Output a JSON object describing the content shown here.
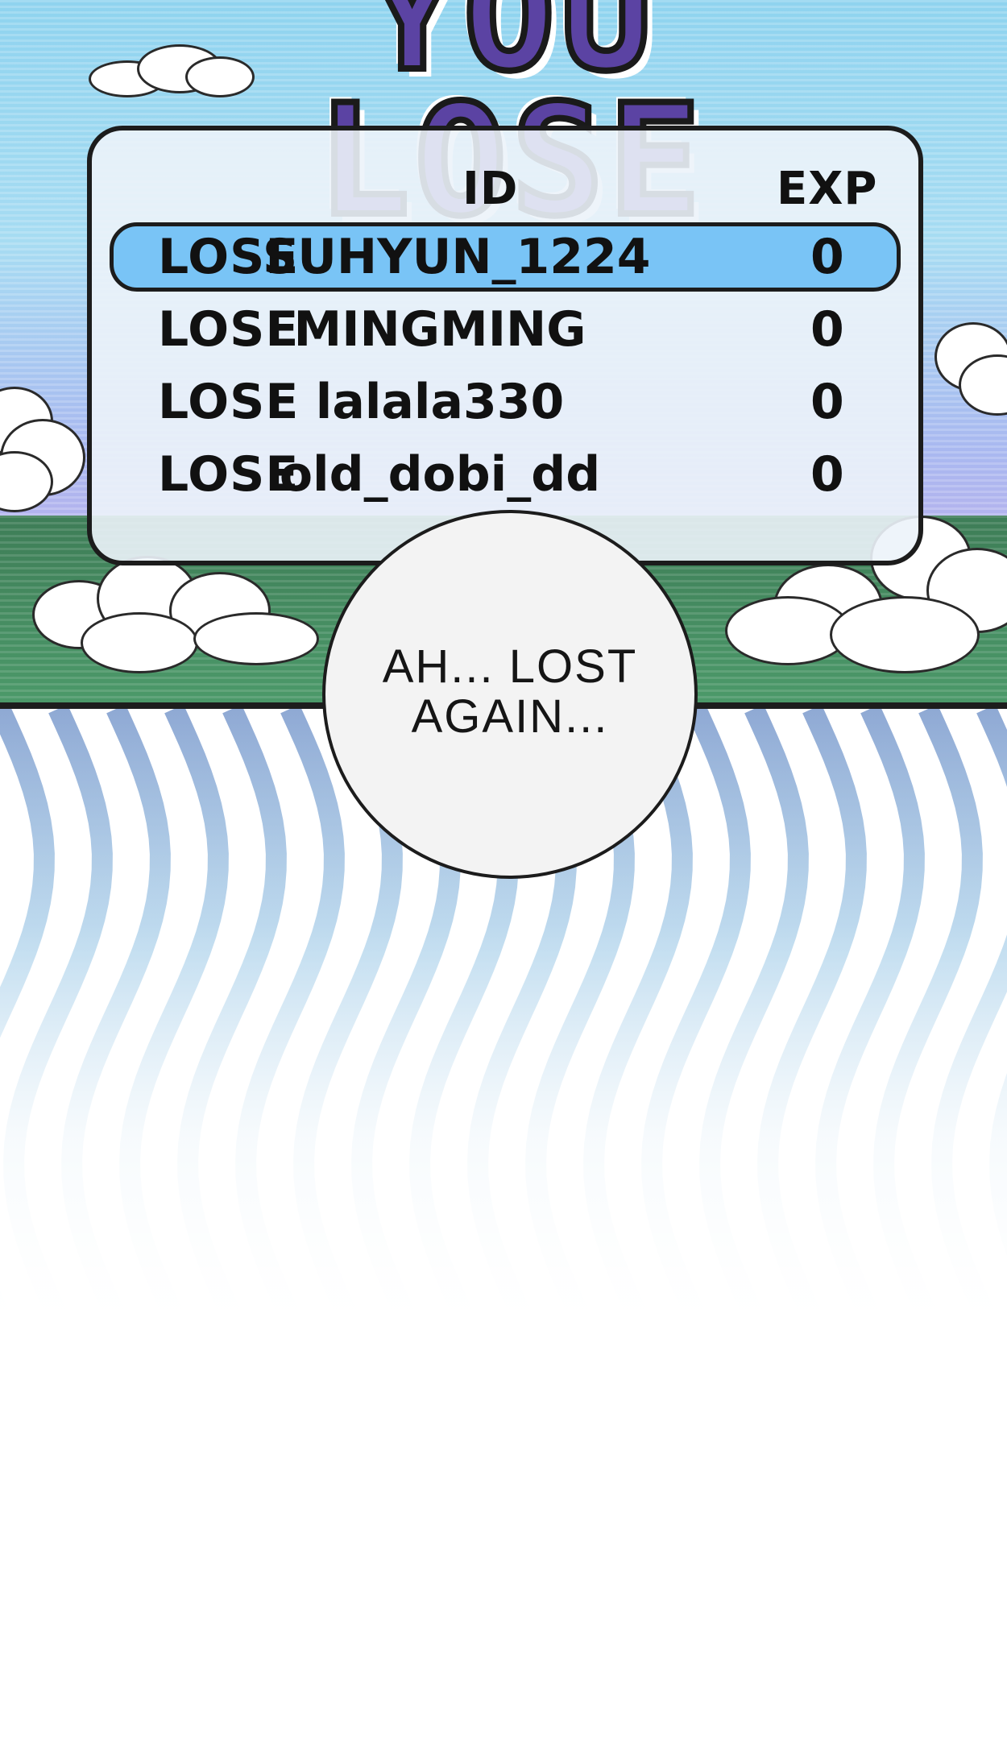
{
  "title": "YOU LOSE",
  "scoreboard": {
    "header": {
      "id_label": "ID",
      "exp_label": "EXP"
    },
    "rows": [
      {
        "status": "LOSE",
        "id": "SUHYUN_1224",
        "exp": "0"
      },
      {
        "status": "LOSE",
        "id": "MINGMING",
        "exp": "0"
      },
      {
        "status": "LOSE",
        "id": "lalala330",
        "exp": "0"
      },
      {
        "status": "LOSE",
        "id": "old_dobi_dd",
        "exp": "0"
      }
    ]
  },
  "speech_bubble": {
    "line1": "AH... LOST",
    "line2": "AGAIN..."
  },
  "colors": {
    "sky": "#8fd3ef",
    "title_fill": "#5b43a3",
    "highlight_row": "#79c4f6",
    "ground": "#4c9a6a"
  }
}
